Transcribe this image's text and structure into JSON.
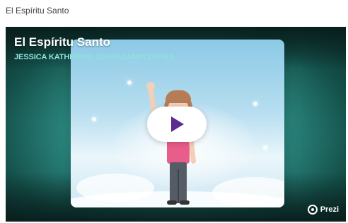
{
  "page": {
    "title": "El Espíritu Santo"
  },
  "embed": {
    "title": "El Espíritu Santo",
    "author": "JESSICA KATHERINE GUAYASAMIN DEFAS",
    "play_icon": "play-icon",
    "brand": "Prezi",
    "brand_icon": "prezi-icon"
  },
  "colors": {
    "accent_play": "#5c2d91",
    "author_text": "#8fe3db",
    "embed_bg": "#38aaa0"
  }
}
